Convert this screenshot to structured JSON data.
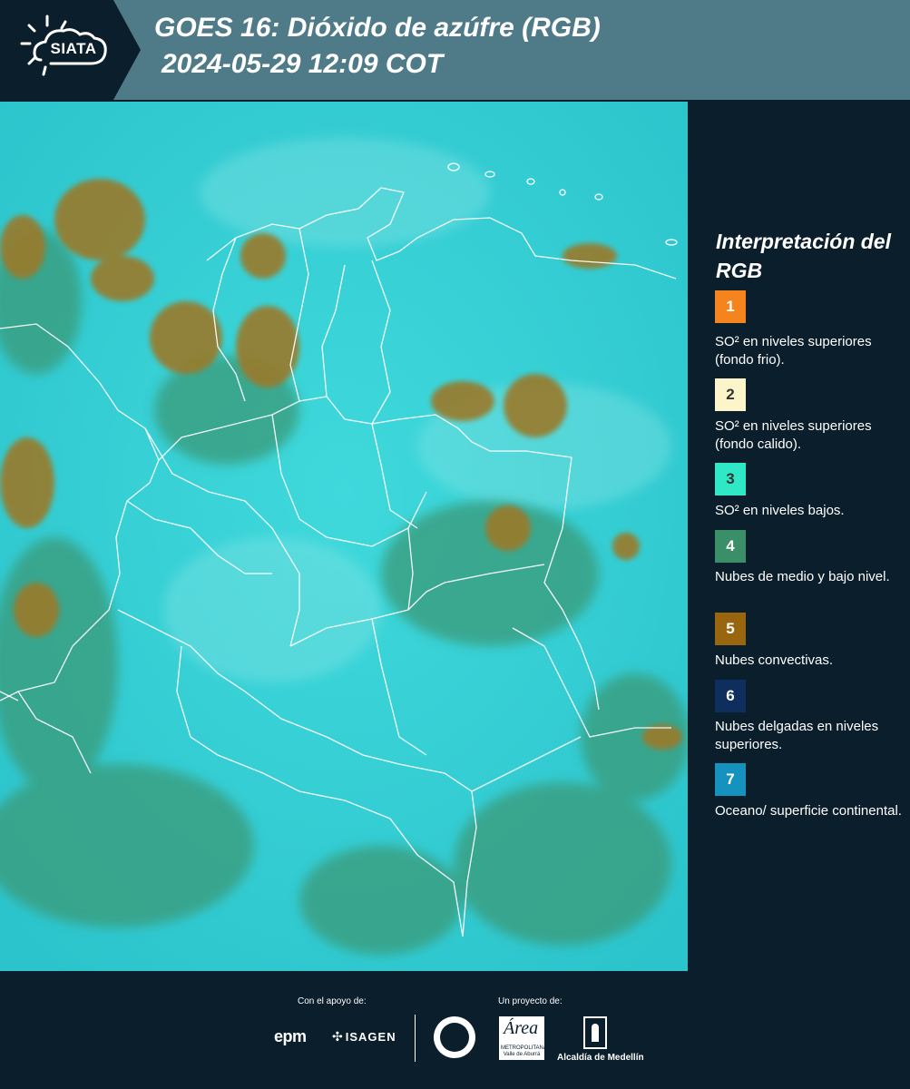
{
  "header": {
    "logo_text": "SIATA",
    "title_line1": "GOES 16: Dióxido de azúfre (RGB)",
    "title_line2": "2024-05-29 12:09 COT",
    "background_color": "#4f7a88",
    "logo_panel_color": "#0b1e2b"
  },
  "legend": {
    "title": "Interpretación del RGB",
    "items": [
      {
        "number": "1",
        "label": "SO² en niveles superiores (fondo frio).",
        "color": "#f5841f",
        "text_color": "#ffffff"
      },
      {
        "number": "2",
        "label": "SO² en niveles superiores (fondo calido).",
        "color": "#fcf5c9",
        "text_color": "#333333"
      },
      {
        "number": "3",
        "label": "SO² en niveles bajos.",
        "color": "#2ee8c6",
        "text_color": "#333333"
      },
      {
        "number": "4",
        "label": "Nubes de medio y bajo nivel.",
        "color": "#3a8f68",
        "text_color": "#ffffff"
      },
      {
        "number": "5",
        "label": "Nubes convectivas.",
        "color": "#9a650f",
        "text_color": "#ffffff"
      },
      {
        "number": "6",
        "label": "Nubes delgadas en niveles superiores.",
        "color": "#0e2f5e",
        "text_color": "#ffffff"
      },
      {
        "number": "7",
        "label": "Oceano/ superficie continental.",
        "color": "#1592be",
        "text_color": "#ffffff"
      }
    ]
  },
  "footer": {
    "support_caption": "Con el apoyo de:",
    "project_caption": "Un proyecto de:",
    "epm": "epm",
    "isagen": "ISAGEN",
    "area_script": "Área",
    "area_sub": "METROPOLITANA Valle de Aburrá",
    "alcaldia": "Alcaldía de Medellín"
  },
  "map": {
    "ocean_color": "#30c9cf",
    "convective_color": "#9a7a2c",
    "mid_low_cloud_color": "#3a9a78",
    "border_color": "#ffffff"
  }
}
